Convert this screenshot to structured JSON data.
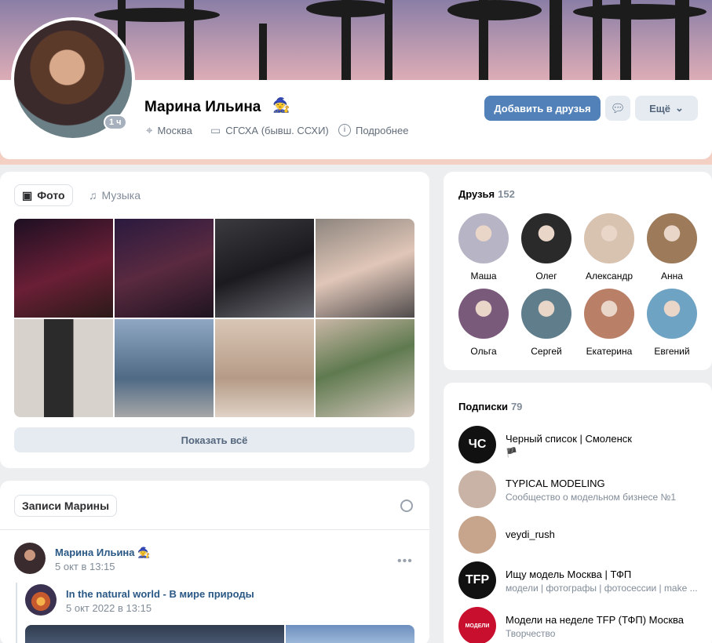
{
  "profile": {
    "name": "Марина Ильина",
    "name_emoji": "🧙",
    "online_badge": "1 ч",
    "city": "Москва",
    "education": "СГСХА (бывш. ССХИ)",
    "details_link": "Подробнее",
    "add_friend_label": "Добавить в друзья",
    "more_label": "Ещё"
  },
  "photos": {
    "tab_photos": "Фото",
    "tab_music": "Музыка",
    "show_all": "Показать всё",
    "colors": [
      "#3a1a2a",
      "#4a2434",
      "#2e2b30",
      "#b9a89e",
      "#d9d3c8",
      "#6f8aa8",
      "#c8b9ad",
      "#c7b8ae"
    ]
  },
  "wall": {
    "tab_label": "Записи Марины",
    "post": {
      "author": "Марина Ильина",
      "date": "5 окт в 13:15",
      "repost_title": "In the natural world - В мире природы",
      "repost_date": "5 окт 2022 в 13:15"
    }
  },
  "friends": {
    "title": "Друзья",
    "count": "152",
    "items": [
      {
        "name": "Маша",
        "color": "#b7b4c6"
      },
      {
        "name": "Олег",
        "color": "#2a2a2a"
      },
      {
        "name": "Александр",
        "color": "#d8c2b0"
      },
      {
        "name": "Анна",
        "color": "#9c7a5a"
      },
      {
        "name": "Ольга",
        "color": "#7a5a7a"
      },
      {
        "name": "Сергей",
        "color": "#5f7d8a"
      },
      {
        "name": "Екатерина",
        "color": "#b98067"
      },
      {
        "name": "Евгений",
        "color": "#6ea3c4"
      }
    ]
  },
  "subscriptions": {
    "title": "Подписки",
    "count": "79",
    "items": [
      {
        "name": "Черный список | Смоленск",
        "desc": "🏴",
        "avatar_text": "ЧС",
        "color": "#111111"
      },
      {
        "name": "TYPICAL MODELING",
        "desc": "Сообщество о модельном бизнесе №1",
        "avatar_text": "",
        "color": "#c9b3a6"
      },
      {
        "name": "veydi_rush",
        "desc": "",
        "avatar_text": "",
        "color": "#c7a48c"
      },
      {
        "name": "Ищу модель Москва | ТФП",
        "desc": "модели | фотографы | фотосессии | make ...",
        "avatar_text": "TFP",
        "color": "#111111"
      },
      {
        "name": "Модели на неделе TFP (ТФП) Москва",
        "desc": "Творчество",
        "avatar_text": "МОДЕЛИ",
        "color": "#c8102e"
      }
    ]
  }
}
